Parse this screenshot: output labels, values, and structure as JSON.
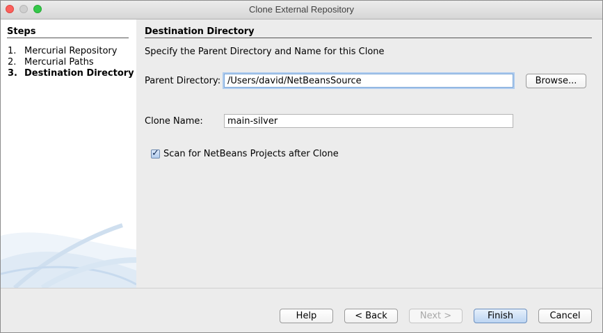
{
  "window": {
    "title": "Clone External Repository"
  },
  "steps": {
    "heading": "Steps",
    "items": [
      {
        "num": "1.",
        "label": "Mercurial Repository"
      },
      {
        "num": "2.",
        "label": "Mercurial Paths"
      },
      {
        "num": "3.",
        "label": "Destination Directory"
      }
    ]
  },
  "content": {
    "heading": "Destination Directory",
    "description": "Specify the Parent Directory and Name for this Clone",
    "parent_label": "Parent Directory:",
    "parent_value": "/Users/david/NetBeansSource",
    "browse_label": "Browse...",
    "clone_label": "Clone Name:",
    "clone_value": "main-silver",
    "scan_label": "Scan for NetBeans Projects after Clone",
    "scan_checked": true
  },
  "buttons": {
    "help": "Help",
    "back": "< Back",
    "next": "Next >",
    "finish": "Finish",
    "cancel": "Cancel"
  }
}
